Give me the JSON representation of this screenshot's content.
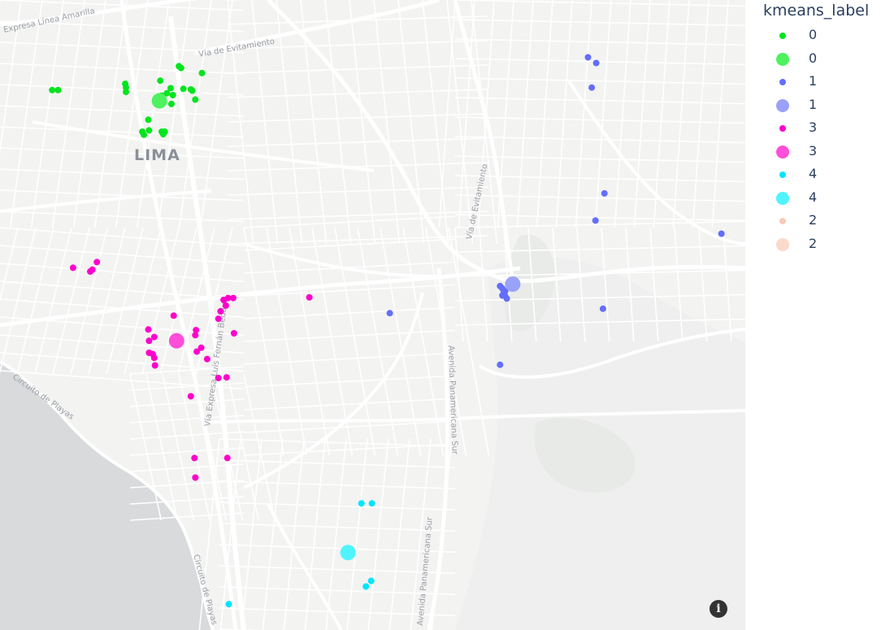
{
  "legend": {
    "title": "kmeans_label",
    "items": [
      {
        "label": "0",
        "color": "#00e51d",
        "kind": "point"
      },
      {
        "label": "0",
        "color": "#4ef25f",
        "kind": "centroid"
      },
      {
        "label": "1",
        "color": "#636efa",
        "kind": "point"
      },
      {
        "label": "1",
        "color": "#9aa1f8",
        "kind": "centroid"
      },
      {
        "label": "3",
        "color": "#ff00cc",
        "kind": "point"
      },
      {
        "label": "3",
        "color": "#ff4fd8",
        "kind": "centroid"
      },
      {
        "label": "4",
        "color": "#00e5ff",
        "kind": "point"
      },
      {
        "label": "4",
        "color": "#4ff4ff",
        "kind": "centroid"
      },
      {
        "label": "2",
        "color": "#f8c9b6",
        "kind": "point"
      },
      {
        "label": "2",
        "color": "#fbd9cb",
        "kind": "centroid"
      }
    ]
  },
  "map": {
    "place_labels": [
      "LIMA"
    ],
    "road_labels": [
      "Expresa Línea Amarilla",
      "Vía de Evitamiento",
      "Vía de Evitamiento",
      "Circuito de Playas",
      "Circuito de Playas",
      "Vía Expresa Luis Fernán Bedoya",
      "Avenida Panamericana Sur",
      "Avenida Panamericana Sur"
    ],
    "land_color": "#f3f3f2",
    "water_color": "#d8dadc",
    "road_color": "#ffffff"
  },
  "info_button": {
    "glyph": "i"
  },
  "chart_data": {
    "type": "scatter",
    "title": "",
    "legend_title": "kmeans_label",
    "legend_position": "right",
    "series": [
      {
        "name": "0",
        "kind": "points",
        "color": "#00e51d",
        "x": [
          0.07,
          0.078,
          0.168,
          0.169,
          0.169,
          0.199,
          0.2,
          0.215,
          0.217,
          0.224,
          0.229,
          0.23,
          0.232,
          0.24,
          0.243,
          0.246,
          0.256,
          0.258,
          0.262,
          0.271,
          0.217,
          0.219,
          0.221,
          0.191,
          0.193
        ],
        "y": [
          0.143,
          0.143,
          0.133,
          0.139,
          0.146,
          0.19,
          0.207,
          0.128,
          0.152,
          0.148,
          0.14,
          0.165,
          0.151,
          0.105,
          0.108,
          0.141,
          0.142,
          0.144,
          0.158,
          0.116,
          0.209,
          0.213,
          0.209,
          0.209,
          0.214
        ]
      },
      {
        "name": "0",
        "kind": "centroid",
        "color": "#4ef25f",
        "x": [
          0.214
        ],
        "y": [
          0.16
        ]
      },
      {
        "name": "1",
        "kind": "points",
        "color": "#636efa",
        "x": [
          0.789,
          0.8,
          0.794,
          0.811,
          0.799,
          0.968,
          0.523,
          0.671,
          0.674,
          0.676,
          0.678,
          0.68,
          0.674,
          0.678,
          0.809,
          0.671
        ],
        "y": [
          0.091,
          0.1,
          0.139,
          0.307,
          0.35,
          0.371,
          0.497,
          0.454,
          0.458,
          0.465,
          0.47,
          0.474,
          0.469,
          0.462,
          0.49,
          0.579
        ]
      },
      {
        "name": "1",
        "kind": "centroid",
        "color": "#9aa1f8",
        "x": [
          0.688
        ],
        "y": [
          0.451
        ]
      },
      {
        "name": "3",
        "kind": "points",
        "color": "#ff00cc",
        "x": [
          0.098,
          0.121,
          0.124,
          0.13,
          0.199,
          0.2,
          0.2,
          0.205,
          0.207,
          0.207,
          0.208,
          0.233,
          0.263,
          0.27,
          0.278,
          0.293,
          0.296,
          0.3,
          0.303,
          0.306,
          0.313,
          0.314,
          0.304,
          0.415,
          0.256,
          0.261,
          0.305,
          0.262,
          0.264,
          0.262,
          0.293
        ],
        "y": [
          0.425,
          0.431,
          0.428,
          0.416,
          0.523,
          0.541,
          0.56,
          0.562,
          0.535,
          0.568,
          0.58,
          0.501,
          0.524,
          0.552,
          0.57,
          0.506,
          0.494,
          0.476,
          0.485,
          0.473,
          0.473,
          0.529,
          0.599,
          0.472,
          0.629,
          0.727,
          0.727,
          0.758,
          0.558,
          0.532,
          0.6
        ]
      },
      {
        "name": "3",
        "kind": "centroid",
        "color": "#ff4fd8",
        "x": [
          0.237
        ],
        "y": [
          0.541
        ]
      },
      {
        "name": "4",
        "kind": "points",
        "color": "#00e5ff",
        "x": [
          0.485,
          0.499,
          0.491,
          0.498,
          0.307
        ],
        "y": [
          0.799,
          0.799,
          0.931,
          0.922,
          0.959
        ]
      },
      {
        "name": "4",
        "kind": "centroid",
        "color": "#4ff4ff",
        "x": [
          0.467
        ],
        "y": [
          0.877
        ]
      }
    ]
  }
}
